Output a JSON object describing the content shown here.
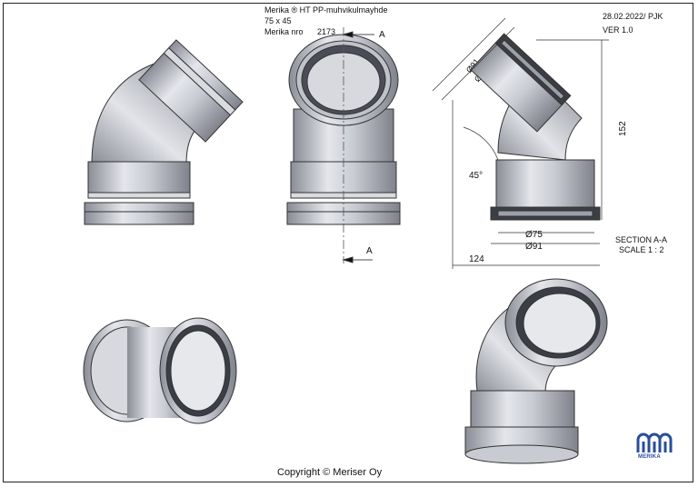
{
  "title_block": {
    "product_line": "Merika ® HT PP-muhvikulmayhde",
    "size": "75 x 45",
    "merika_nro_label": "Merika nro",
    "merika_nro_value": "2173",
    "date_author": "28.02.2022/ PJK",
    "version": "VER 1.0"
  },
  "section": {
    "marker_letter": "A",
    "label": "SECTION A-A",
    "scale": "SCALE 1 : 2"
  },
  "dimensions": {
    "outer_diameter": "Ø91",
    "inner_diameter": "Ø75",
    "bottom_inner": "Ø75",
    "bottom_outer": "Ø91",
    "height": "152",
    "width": "124",
    "angle": "45°"
  },
  "footer": {
    "copyright": "Copyright © Meriser Oy"
  },
  "logo": {
    "text": "MERIKA",
    "color": "#2a4d9a"
  }
}
